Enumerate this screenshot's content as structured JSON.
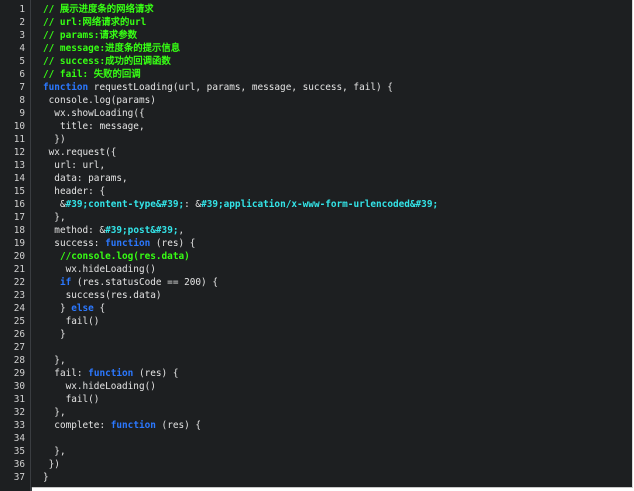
{
  "colors": {
    "background": "#1d1f21",
    "line_numbers": "#d0d0d0",
    "comment": "#37ff14",
    "keyword": "#2b78ff",
    "string": "#33e4e8",
    "plain": "#e4e4e4"
  },
  "lines": [
    {
      "n": "1",
      "indent": "",
      "tokens": [
        {
          "t": "c",
          "v": "// 展示进度条的网络请求"
        }
      ]
    },
    {
      "n": "2",
      "indent": "",
      "tokens": [
        {
          "t": "c",
          "v": "// url:网络请求的url"
        }
      ]
    },
    {
      "n": "3",
      "indent": "",
      "tokens": [
        {
          "t": "c",
          "v": "// params:请求参数"
        }
      ]
    },
    {
      "n": "4",
      "indent": "",
      "tokens": [
        {
          "t": "c",
          "v": "// message:进度条的提示信息"
        }
      ]
    },
    {
      "n": "5",
      "indent": "",
      "tokens": [
        {
          "t": "c",
          "v": "// success:成功的回调函数"
        }
      ]
    },
    {
      "n": "6",
      "indent": "",
      "tokens": [
        {
          "t": "c",
          "v": "// fail: 失败的回调"
        }
      ]
    },
    {
      "n": "7",
      "indent": "",
      "tokens": [
        {
          "t": "k",
          "v": "function"
        },
        {
          "t": "p",
          "v": " requestLoading(url, params, message, success, fail) {"
        }
      ]
    },
    {
      "n": "8",
      "indent": " ",
      "tokens": [
        {
          "t": "p",
          "v": "console.log(params)"
        }
      ]
    },
    {
      "n": "9",
      "indent": "  ",
      "tokens": [
        {
          "t": "p",
          "v": "wx.showLoading({"
        }
      ]
    },
    {
      "n": "10",
      "indent": "   ",
      "tokens": [
        {
          "t": "p",
          "v": "title: message,"
        }
      ]
    },
    {
      "n": "11",
      "indent": "  ",
      "tokens": [
        {
          "t": "p",
          "v": "})"
        }
      ]
    },
    {
      "n": "12",
      "indent": " ",
      "tokens": [
        {
          "t": "p",
          "v": "wx.request({"
        }
      ]
    },
    {
      "n": "13",
      "indent": "  ",
      "tokens": [
        {
          "t": "p",
          "v": "url: url,"
        }
      ]
    },
    {
      "n": "14",
      "indent": "  ",
      "tokens": [
        {
          "t": "p",
          "v": "data: params,"
        }
      ]
    },
    {
      "n": "15",
      "indent": "  ",
      "tokens": [
        {
          "t": "p",
          "v": "header: {"
        }
      ]
    },
    {
      "n": "16",
      "indent": "   ",
      "tokens": [
        {
          "t": "p",
          "v": "&"
        },
        {
          "t": "s",
          "v": "#39;content-type&#39;"
        },
        {
          "t": "p",
          "v": ": &"
        },
        {
          "t": "s",
          "v": "#39;application/x-www-form-urlencoded&#39;"
        }
      ]
    },
    {
      "n": "17",
      "indent": "  ",
      "tokens": [
        {
          "t": "p",
          "v": "},"
        }
      ]
    },
    {
      "n": "18",
      "indent": "  ",
      "tokens": [
        {
          "t": "p",
          "v": "method: &"
        },
        {
          "t": "s",
          "v": "#39;post&#39;"
        },
        {
          "t": "p",
          "v": ","
        }
      ]
    },
    {
      "n": "19",
      "indent": "  ",
      "tokens": [
        {
          "t": "p",
          "v": "success: "
        },
        {
          "t": "k",
          "v": "function"
        },
        {
          "t": "p",
          "v": " (res) {"
        }
      ]
    },
    {
      "n": "20",
      "indent": "   ",
      "tokens": [
        {
          "t": "c",
          "v": "//console.log(res.data)"
        }
      ]
    },
    {
      "n": "21",
      "indent": "    ",
      "tokens": [
        {
          "t": "p",
          "v": "wx.hideLoading()"
        }
      ]
    },
    {
      "n": "22",
      "indent": "   ",
      "tokens": [
        {
          "t": "k",
          "v": "if"
        },
        {
          "t": "p",
          "v": " (res.statusCode == 200) {"
        }
      ]
    },
    {
      "n": "23",
      "indent": "    ",
      "tokens": [
        {
          "t": "p",
          "v": "success(res.data)"
        }
      ]
    },
    {
      "n": "24",
      "indent": "   ",
      "tokens": [
        {
          "t": "p",
          "v": "} "
        },
        {
          "t": "k",
          "v": "else"
        },
        {
          "t": "p",
          "v": " {"
        }
      ]
    },
    {
      "n": "25",
      "indent": "    ",
      "tokens": [
        {
          "t": "p",
          "v": "fail()"
        }
      ]
    },
    {
      "n": "26",
      "indent": "   ",
      "tokens": [
        {
          "t": "p",
          "v": "}"
        }
      ]
    },
    {
      "n": "27",
      "indent": "",
      "tokens": []
    },
    {
      "n": "28",
      "indent": "  ",
      "tokens": [
        {
          "t": "p",
          "v": "},"
        }
      ]
    },
    {
      "n": "29",
      "indent": "  ",
      "tokens": [
        {
          "t": "p",
          "v": "fail: "
        },
        {
          "t": "k",
          "v": "function"
        },
        {
          "t": "p",
          "v": " (res) {"
        }
      ]
    },
    {
      "n": "30",
      "indent": "    ",
      "tokens": [
        {
          "t": "p",
          "v": "wx.hideLoading()"
        }
      ]
    },
    {
      "n": "31",
      "indent": "    ",
      "tokens": [
        {
          "t": "p",
          "v": "fail()"
        }
      ]
    },
    {
      "n": "32",
      "indent": "  ",
      "tokens": [
        {
          "t": "p",
          "v": "},"
        }
      ]
    },
    {
      "n": "33",
      "indent": "  ",
      "tokens": [
        {
          "t": "p",
          "v": "complete: "
        },
        {
          "t": "k",
          "v": "function"
        },
        {
          "t": "p",
          "v": " (res) {"
        }
      ]
    },
    {
      "n": "34",
      "indent": "",
      "tokens": []
    },
    {
      "n": "35",
      "indent": "  ",
      "tokens": [
        {
          "t": "p",
          "v": "},"
        }
      ]
    },
    {
      "n": "36",
      "indent": " ",
      "tokens": [
        {
          "t": "p",
          "v": "})"
        }
      ]
    },
    {
      "n": "37",
      "indent": "",
      "tokens": [
        {
          "t": "p",
          "v": "}"
        }
      ]
    }
  ]
}
